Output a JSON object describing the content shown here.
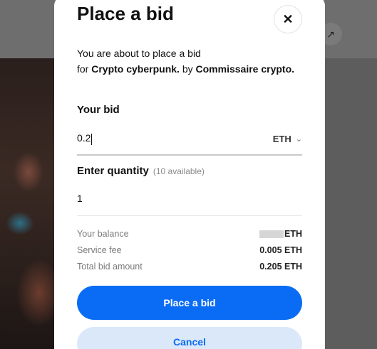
{
  "background": {
    "share_icon": "arrow-up-right-icon",
    "share_glyph": "↗"
  },
  "modal": {
    "title": "Place a bid",
    "close_glyph": "✕",
    "intro_prefix": "You are about to place a bid",
    "intro_for": "for",
    "item_name": "Crypto cyberpunk.",
    "intro_by": "by",
    "creator": "Commissaire crypto."
  },
  "bid": {
    "label": "Your bid",
    "value": "0.2",
    "currency": "ETH",
    "chevron": "⌄"
  },
  "quantity": {
    "label": "Enter quantity",
    "available": "(10 available)",
    "value": "1"
  },
  "summary": {
    "balance_label": "Your balance",
    "balance_currency": "ETH",
    "fee_label": "Service fee",
    "fee_value": "0.005 ETH",
    "total_label": "Total bid amount",
    "total_value": "0.205 ETH"
  },
  "actions": {
    "place_bid": "Place a bid",
    "cancel": "Cancel"
  },
  "colors": {
    "primary": "#0a6cf4",
    "secondary_bg": "#dbe8f9",
    "overlay": "#5a5a5a"
  }
}
